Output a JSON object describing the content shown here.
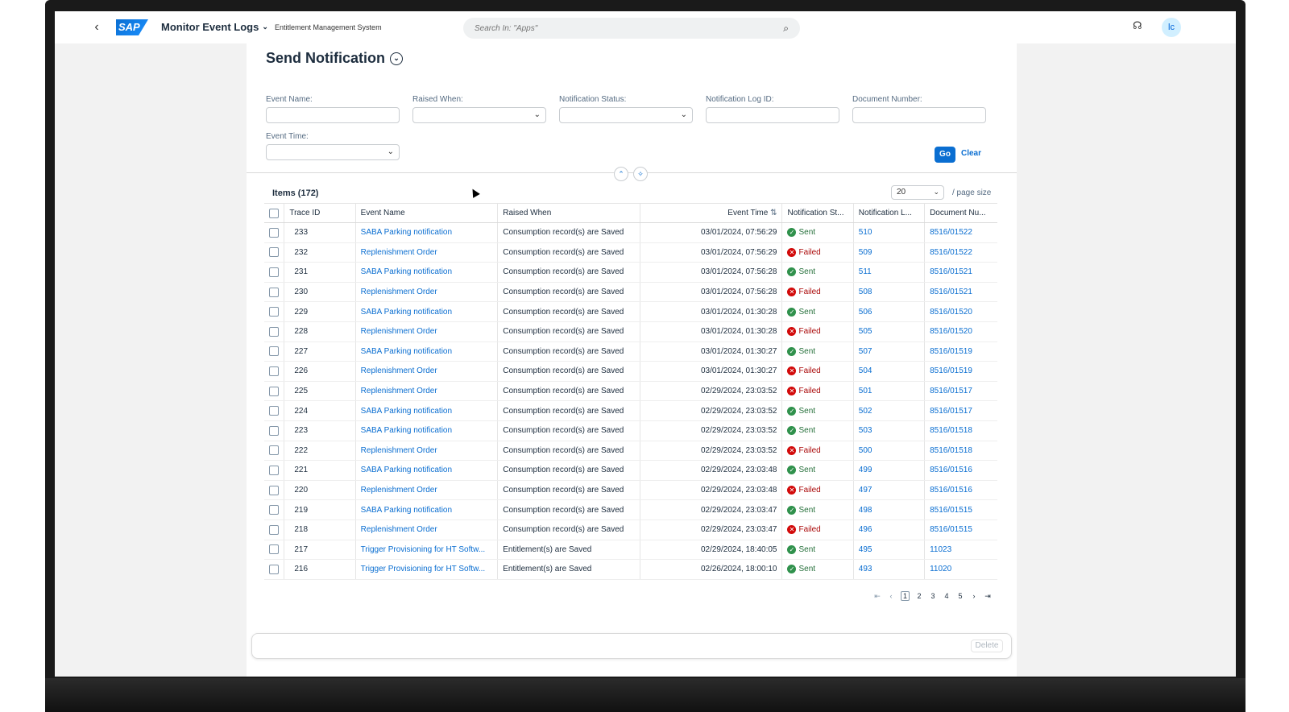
{
  "shell": {
    "app_title": "Monitor Event Logs",
    "app_subtitle": "Entitlement Management System",
    "search_placeholder": "Search In: \"Apps\"",
    "logo_text": "SAP",
    "avatar_initials": "lc"
  },
  "page": {
    "title": "Send Notification"
  },
  "filters": {
    "event_name_label": "Event Name:",
    "raised_when_label": "Raised When:",
    "notification_status_label": "Notification Status:",
    "notification_log_id_label": "Notification Log ID:",
    "document_number_label": "Document Number:",
    "event_time_label": "Event Time:",
    "go_label": "Go",
    "clear_label": "Clear"
  },
  "table": {
    "items_title": "Items (172)",
    "page_size": "20",
    "page_size_label": "/ page size",
    "columns": [
      "Trace ID",
      "Event Name",
      "Raised When",
      "Event Time",
      "Notification St...",
      "Notification L...",
      "Document Nu..."
    ],
    "rows": [
      {
        "trace_id": "233",
        "event_name": "SABA Parking notification",
        "raised_when": "Consumption record(s) are Saved",
        "event_time": "03/01/2024, 07:56:29",
        "status": "Sent",
        "log_id": "510",
        "doc_no": "8516/01522"
      },
      {
        "trace_id": "232",
        "event_name": "Replenishment Order",
        "raised_when": "Consumption record(s) are Saved",
        "event_time": "03/01/2024, 07:56:29",
        "status": "Failed",
        "log_id": "509",
        "doc_no": "8516/01522"
      },
      {
        "trace_id": "231",
        "event_name": "SABA Parking notification",
        "raised_when": "Consumption record(s) are Saved",
        "event_time": "03/01/2024, 07:56:28",
        "status": "Sent",
        "log_id": "511",
        "doc_no": "8516/01521"
      },
      {
        "trace_id": "230",
        "event_name": "Replenishment Order",
        "raised_when": "Consumption record(s) are Saved",
        "event_time": "03/01/2024, 07:56:28",
        "status": "Failed",
        "log_id": "508",
        "doc_no": "8516/01521"
      },
      {
        "trace_id": "229",
        "event_name": "SABA Parking notification",
        "raised_when": "Consumption record(s) are Saved",
        "event_time": "03/01/2024, 01:30:28",
        "status": "Sent",
        "log_id": "506",
        "doc_no": "8516/01520"
      },
      {
        "trace_id": "228",
        "event_name": "Replenishment Order",
        "raised_when": "Consumption record(s) are Saved",
        "event_time": "03/01/2024, 01:30:28",
        "status": "Failed",
        "log_id": "505",
        "doc_no": "8516/01520"
      },
      {
        "trace_id": "227",
        "event_name": "SABA Parking notification",
        "raised_when": "Consumption record(s) are Saved",
        "event_time": "03/01/2024, 01:30:27",
        "status": "Sent",
        "log_id": "507",
        "doc_no": "8516/01519"
      },
      {
        "trace_id": "226",
        "event_name": "Replenishment Order",
        "raised_when": "Consumption record(s) are Saved",
        "event_time": "03/01/2024, 01:30:27",
        "status": "Failed",
        "log_id": "504",
        "doc_no": "8516/01519"
      },
      {
        "trace_id": "225",
        "event_name": "Replenishment Order",
        "raised_when": "Consumption record(s) are Saved",
        "event_time": "02/29/2024, 23:03:52",
        "status": "Failed",
        "log_id": "501",
        "doc_no": "8516/01517"
      },
      {
        "trace_id": "224",
        "event_name": "SABA Parking notification",
        "raised_when": "Consumption record(s) are Saved",
        "event_time": "02/29/2024, 23:03:52",
        "status": "Sent",
        "log_id": "502",
        "doc_no": "8516/01517"
      },
      {
        "trace_id": "223",
        "event_name": "SABA Parking notification",
        "raised_when": "Consumption record(s) are Saved",
        "event_time": "02/29/2024, 23:03:52",
        "status": "Sent",
        "log_id": "503",
        "doc_no": "8516/01518"
      },
      {
        "trace_id": "222",
        "event_name": "Replenishment Order",
        "raised_when": "Consumption record(s) are Saved",
        "event_time": "02/29/2024, 23:03:52",
        "status": "Failed",
        "log_id": "500",
        "doc_no": "8516/01518"
      },
      {
        "trace_id": "221",
        "event_name": "SABA Parking notification",
        "raised_when": "Consumption record(s) are Saved",
        "event_time": "02/29/2024, 23:03:48",
        "status": "Sent",
        "log_id": "499",
        "doc_no": "8516/01516"
      },
      {
        "trace_id": "220",
        "event_name": "Replenishment Order",
        "raised_when": "Consumption record(s) are Saved",
        "event_time": "02/29/2024, 23:03:48",
        "status": "Failed",
        "log_id": "497",
        "doc_no": "8516/01516"
      },
      {
        "trace_id": "219",
        "event_name": "SABA Parking notification",
        "raised_when": "Consumption record(s) are Saved",
        "event_time": "02/29/2024, 23:03:47",
        "status": "Sent",
        "log_id": "498",
        "doc_no": "8516/01515"
      },
      {
        "trace_id": "218",
        "event_name": "Replenishment Order",
        "raised_when": "Consumption record(s) are Saved",
        "event_time": "02/29/2024, 23:03:47",
        "status": "Failed",
        "log_id": "496",
        "doc_no": "8516/01515"
      },
      {
        "trace_id": "217",
        "event_name": "Trigger Provisioning for HT Softw...",
        "raised_when": "Entitlement(s) are Saved",
        "event_time": "02/29/2024, 18:40:05",
        "status": "Sent",
        "log_id": "495",
        "doc_no": "11023"
      },
      {
        "trace_id": "216",
        "event_name": "Trigger Provisioning for HT Softw...",
        "raised_when": "Entitlement(s) are Saved",
        "event_time": "02/26/2024, 18:00:10",
        "status": "Sent",
        "log_id": "493",
        "doc_no": "11020"
      }
    ]
  },
  "pager": {
    "pages": [
      "1",
      "2",
      "3",
      "4",
      "5"
    ],
    "current": "1"
  },
  "footer": {
    "delete_label": "Delete"
  },
  "colors": {
    "accent": "#0a6ed1",
    "sent": "#30914c",
    "failed": "#d20a0a"
  }
}
